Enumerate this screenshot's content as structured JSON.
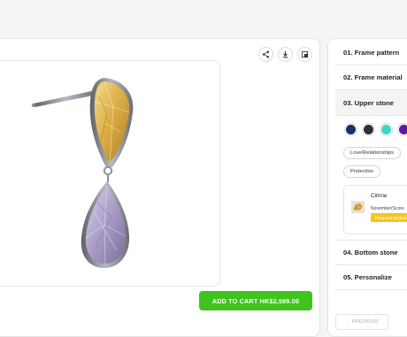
{
  "viewer": {
    "toolbar": {
      "share_icon": "share-icon",
      "download_icon": "download-icon",
      "view_icon": "view-icon"
    },
    "product_image": "teardrop drop earring with yellow upper stone and lavender lower stone",
    "add_to_cart_label": "ADD TO CART HK$2,599.00",
    "colors": {
      "cart_button": "#3fc41d"
    }
  },
  "configurator": {
    "steps": [
      {
        "label": "01. Frame pattern"
      },
      {
        "label": "02. Frame material"
      },
      {
        "label": "03. Upper stone"
      },
      {
        "label": "04. Bottom stone"
      },
      {
        "label": "05. Personalize"
      }
    ],
    "swatches": [
      {
        "name": "navy",
        "color": "#13316a"
      },
      {
        "name": "charcoal",
        "color": "#2e3034"
      },
      {
        "name": "turquoise",
        "color": "#3ad9c8"
      },
      {
        "name": "purple",
        "color": "#5a1aa0"
      }
    ],
    "filter_chips": [
      "Love/Relationships",
      "Protection"
    ],
    "selected_stone": {
      "name": "Citrine",
      "month": "November(Score",
      "tag": "Financial fortune",
      "tag_color": "#f5c518"
    },
    "previous_label": "← PREVIOUS"
  }
}
